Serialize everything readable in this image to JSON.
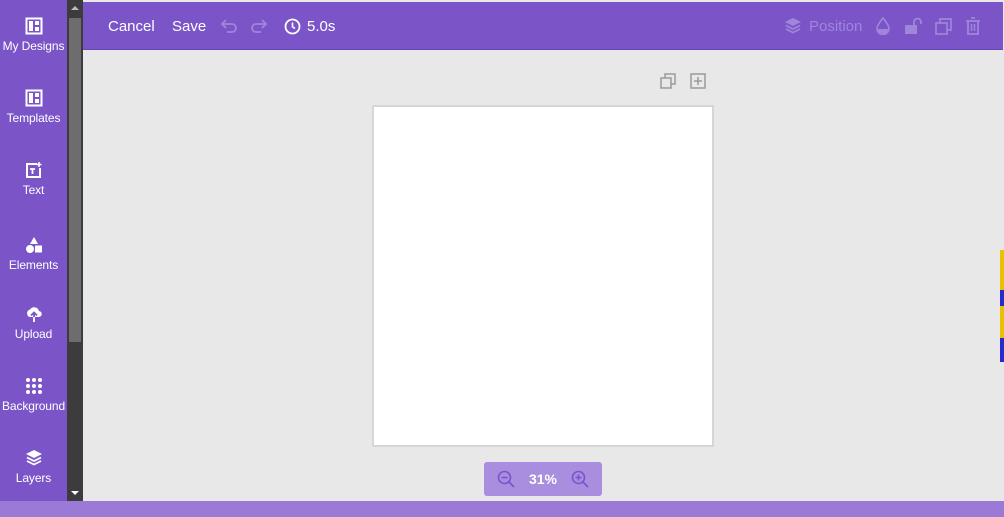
{
  "sidebar": {
    "items": [
      {
        "label": "My Designs",
        "icon": "layout-icon"
      },
      {
        "label": "Templates",
        "icon": "template-icon"
      },
      {
        "label": "Text",
        "icon": "text-add-icon"
      },
      {
        "label": "Elements",
        "icon": "shapes-icon"
      },
      {
        "label": "Upload",
        "icon": "cloud-upload-icon"
      },
      {
        "label": "Background",
        "icon": "dots-grid-icon"
      },
      {
        "label": "Layers",
        "icon": "layers-icon"
      }
    ]
  },
  "toolbar": {
    "cancel_label": "Cancel",
    "save_label": "Save",
    "duration": "5.0s",
    "position_label": "Position"
  },
  "zoom": {
    "level": "31%"
  },
  "colors": {
    "accent": "#7b55c8",
    "zoom_bg": "#a98ee0",
    "dim_icon": "#9f86da",
    "workspace": "#e8e8e8"
  }
}
